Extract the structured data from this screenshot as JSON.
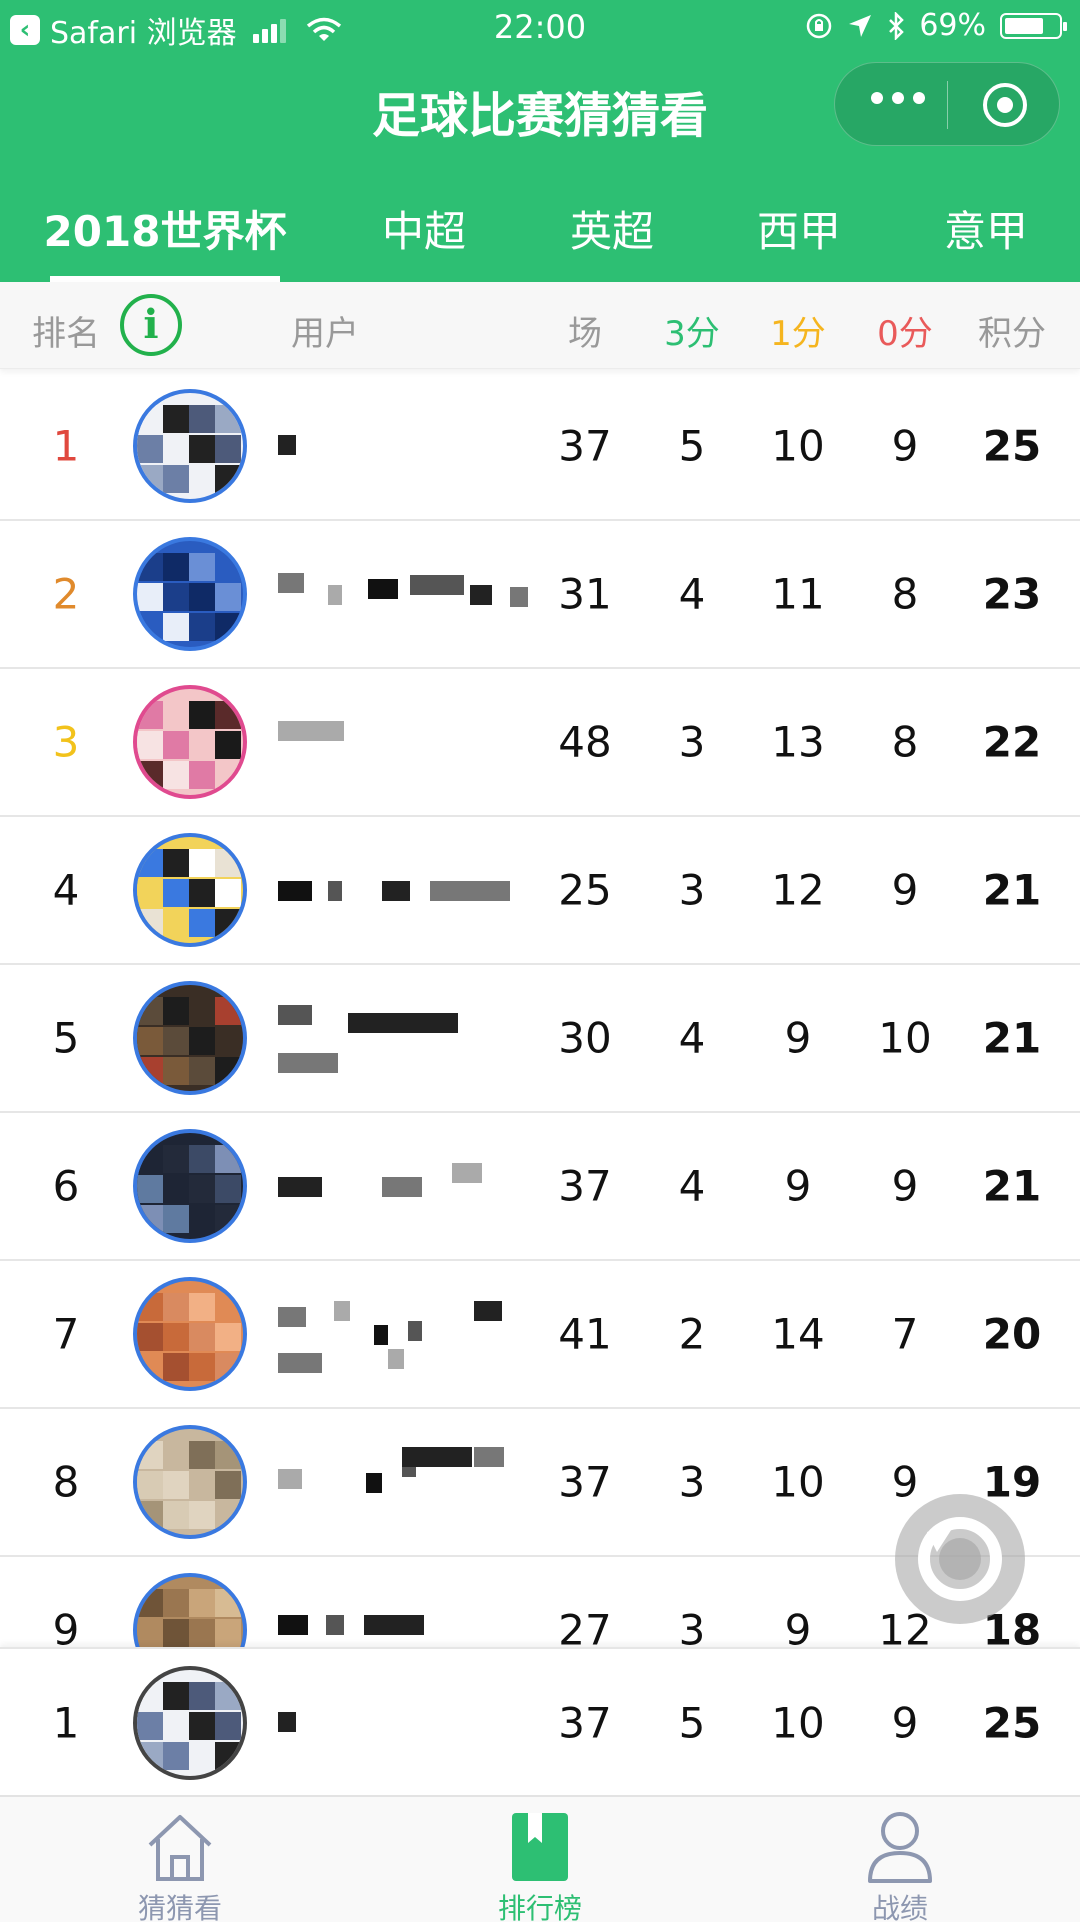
{
  "status_bar": {
    "back_app": "Safari 浏览器",
    "time": "22:00",
    "battery": "69%"
  },
  "nav": {
    "title": "足球比赛猜猜看",
    "more_icon": "more-dots-icon",
    "close_icon": "target-circle-icon"
  },
  "tabs": [
    {
      "label": "2018世界杯",
      "active": true
    },
    {
      "label": "中超",
      "active": false
    },
    {
      "label": "英超",
      "active": false
    },
    {
      "label": "西甲",
      "active": false
    },
    {
      "label": "意甲",
      "active": false
    }
  ],
  "columns": {
    "rank": "排名",
    "user": "用户",
    "games": "场",
    "three": "3分",
    "one": "1分",
    "zero": "0分",
    "points": "积分"
  },
  "colors": {
    "brand_green": "#2dbf73",
    "three_pts": "#2dbf73",
    "one_pt": "#f5b51f",
    "zero_pts": "#e95a5a",
    "rank1": "#e0483e",
    "rank2": "#e08a2c",
    "rank3": "#f2c21b"
  },
  "rows": [
    {
      "rank": "1",
      "games": "37",
      "three": "5",
      "one": "10",
      "zero": "9",
      "points": "25"
    },
    {
      "rank": "2",
      "games": "31",
      "three": "4",
      "one": "11",
      "zero": "8",
      "points": "23"
    },
    {
      "rank": "3",
      "games": "48",
      "three": "3",
      "one": "13",
      "zero": "8",
      "points": "22"
    },
    {
      "rank": "4",
      "games": "25",
      "three": "3",
      "one": "12",
      "zero": "9",
      "points": "21"
    },
    {
      "rank": "5",
      "games": "30",
      "three": "4",
      "one": "9",
      "zero": "10",
      "points": "21"
    },
    {
      "rank": "6",
      "games": "37",
      "three": "4",
      "one": "9",
      "zero": "9",
      "points": "21"
    },
    {
      "rank": "7",
      "games": "41",
      "three": "2",
      "one": "14",
      "zero": "7",
      "points": "20"
    },
    {
      "rank": "8",
      "games": "37",
      "three": "3",
      "one": "10",
      "zero": "9",
      "points": "19"
    },
    {
      "rank": "9",
      "games": "27",
      "three": "3",
      "one": "9",
      "zero": "12",
      "points": "18"
    }
  ],
  "my_row": {
    "rank": "1",
    "games": "37",
    "three": "5",
    "one": "10",
    "zero": "9",
    "points": "25"
  },
  "tabbar": [
    {
      "label": "猜猜看",
      "icon": "home-icon",
      "active": false
    },
    {
      "label": "排行榜",
      "icon": "bookmark-icon",
      "active": true
    },
    {
      "label": "战绩",
      "icon": "user-icon",
      "active": false
    }
  ]
}
